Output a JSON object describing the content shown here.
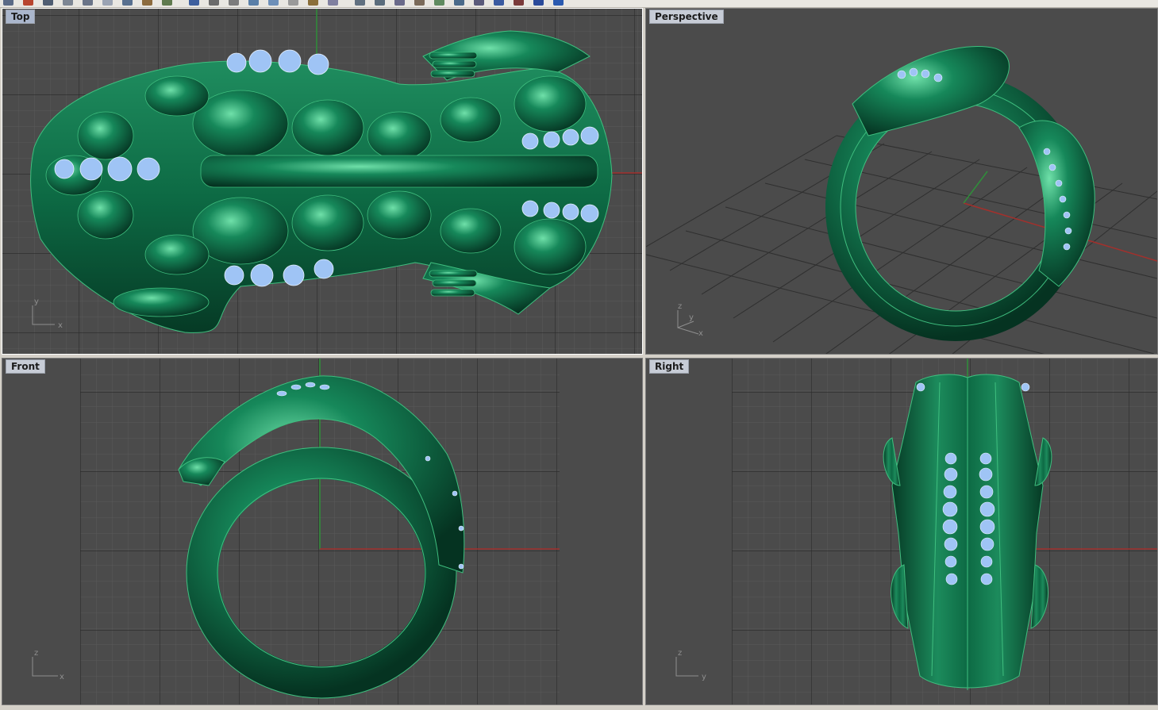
{
  "toolbar": {
    "icons": [
      "new-file-icon",
      "open-file-icon",
      "save-icon",
      "print-icon",
      "cut-icon",
      "copy-icon",
      "paste-icon",
      "undo-icon",
      "redo-icon",
      "pan-icon",
      "rotate-view-icon",
      "zoom-icon",
      "zoom-window-icon",
      "zoom-extents-icon",
      "zoom-selected-icon",
      "named-views-icon",
      "grid-icon",
      "point-icon",
      "curve-icon",
      "circle-icon",
      "arc-icon",
      "rectangle-icon",
      "surface-icon",
      "solid-icon",
      "shade-icon",
      "render-icon",
      "color-icon",
      "help-icon"
    ]
  },
  "viewports": {
    "top": {
      "title": "Top",
      "axis_v": "y",
      "axis_h": "x"
    },
    "perspective": {
      "title": "Perspective",
      "axis_v": "z",
      "axis_h": "x",
      "axis_d": "y"
    },
    "front": {
      "title": "Front",
      "axis_v": "z",
      "axis_h": "x"
    },
    "right": {
      "title": "Right",
      "axis_v": "z",
      "axis_h": "y"
    }
  },
  "colors": {
    "viewport_bg": "#4b4b4b",
    "grid_minor": "#5a5a5a",
    "grid_major": "#2e2e2e",
    "x_axis": "#a3302c",
    "y_axis": "#2f8f3a",
    "model_green": "#0f6b45",
    "model_highlight": "#5fd39a",
    "gem_blue": "#9fc4f5"
  },
  "model": {
    "name": "crocodile-ring",
    "gem_count_visible": "many"
  }
}
